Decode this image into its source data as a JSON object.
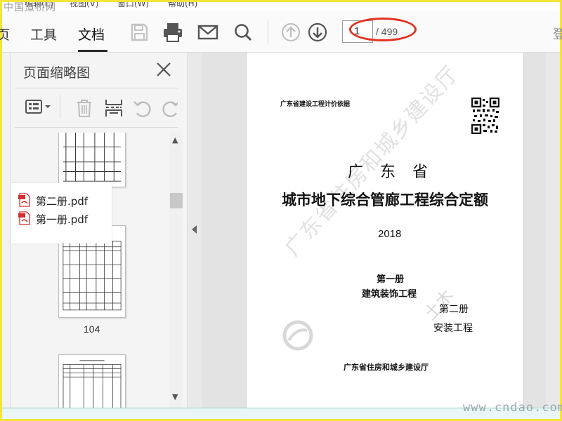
{
  "watermark_top": "中国道桥网",
  "menu": {
    "items": [
      "编辑(E)",
      "视图(V)",
      "窗口(W)",
      "帮助(H)"
    ]
  },
  "toolbar": {
    "tab_partial": "页",
    "tab_tools": "工具",
    "tab_document": "文档",
    "page_current": "1",
    "page_total": "/ 499",
    "right_partial": "登"
  },
  "sidebar": {
    "title": "页面缩略图",
    "thumb_label": "104"
  },
  "popup": {
    "files": [
      "第二册.pdf",
      "第一册.pdf"
    ]
  },
  "document": {
    "header_left": "广东省建设工程计价依据",
    "title_line1": "广　东　省",
    "title_line2": "城市地下综合管廊工程综合定额",
    "year": "2018",
    "vol1": "第一册",
    "vol1_name": "建筑装饰工程",
    "vol2": "第二册",
    "vol2_name": "安装工程",
    "publisher": "广东省住房和城乡建设厅",
    "stamp_text": "广东省住房和城乡建设厅",
    "stamp_extra": "土木"
  },
  "bottom_watermark": "www.cndao.com",
  "colors": {
    "highlight_ellipse": "#e23222",
    "frame": "#f5e43a"
  }
}
